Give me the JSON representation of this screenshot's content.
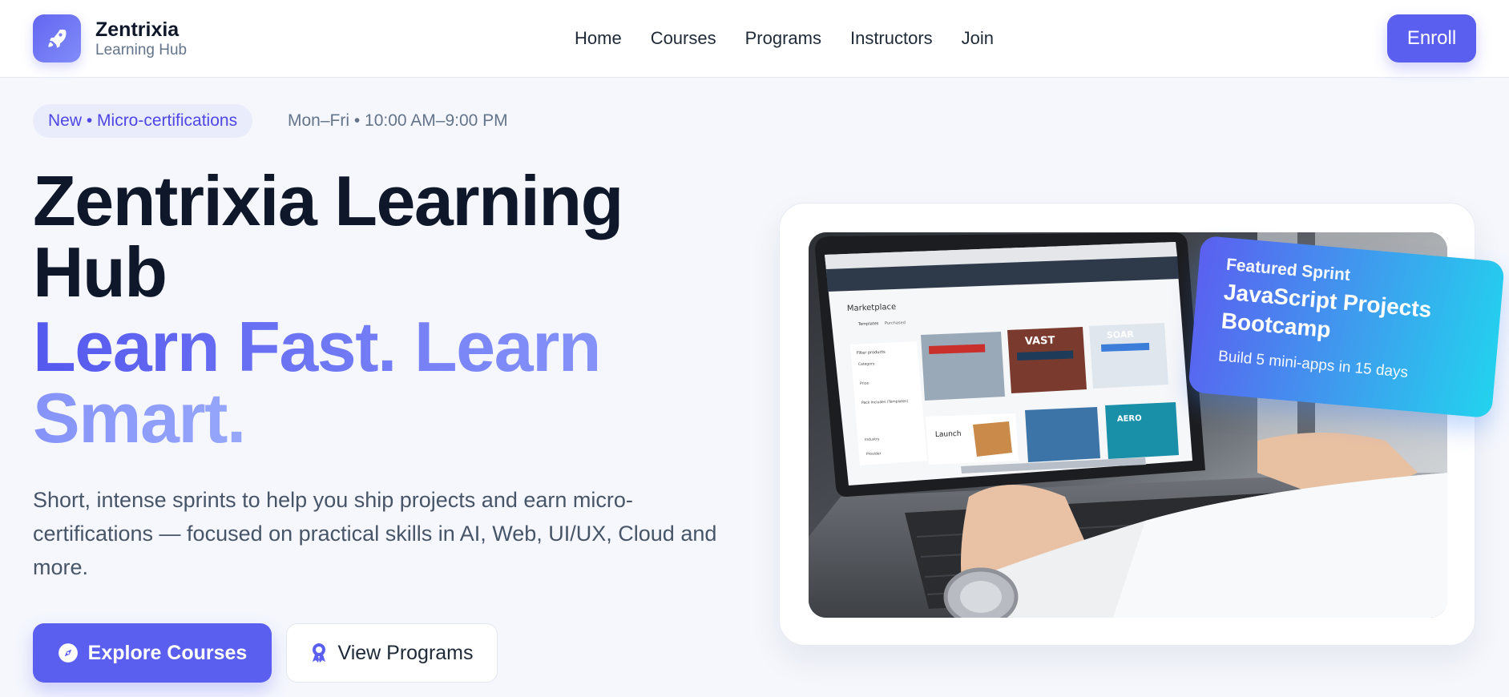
{
  "header": {
    "brand_name": "Zentrixia",
    "brand_sub": "Learning Hub",
    "nav": [
      "Home",
      "Courses",
      "Programs",
      "Instructors",
      "Join"
    ],
    "enroll_label": "Enroll"
  },
  "hero": {
    "pill": "New • Micro-certifications",
    "schedule": "Mon–Fri • 10:00 AM–9:00 PM",
    "title": "Zentrixia Learning Hub",
    "tagline": "Learn Fast. Learn Smart.",
    "description": "Short, intense sprints to help you ship projects and earn micro-certifications — focused on practical skills in AI, Web, UI/UX, Cloud and more.",
    "primary_cta": "Explore Courses",
    "secondary_cta": "View Programs"
  },
  "featured": {
    "label": "Featured Sprint",
    "title": "JavaScript Projects Bootcamp",
    "subtitle": "Build 5 mini-apps in 15 days"
  },
  "screen": {
    "app_header": "Marketplace",
    "tabs": [
      "Templates",
      "Purchased"
    ],
    "filter_title": "Filter products",
    "filter_groups": [
      "Category",
      "Price",
      "Pack includes (Templates)",
      "Industry",
      "Provider"
    ],
    "templates": [
      "VAST",
      "SOAR",
      "Launch",
      "AERO"
    ]
  },
  "colors": {
    "primary": "#5b5ff0",
    "ink": "#0f172a",
    "muted": "#64748b",
    "accent_cyan": "#22d3ee"
  },
  "icons": {
    "logo": "rocket-icon",
    "primary_cta": "compass-icon",
    "secondary_cta": "award-icon"
  }
}
